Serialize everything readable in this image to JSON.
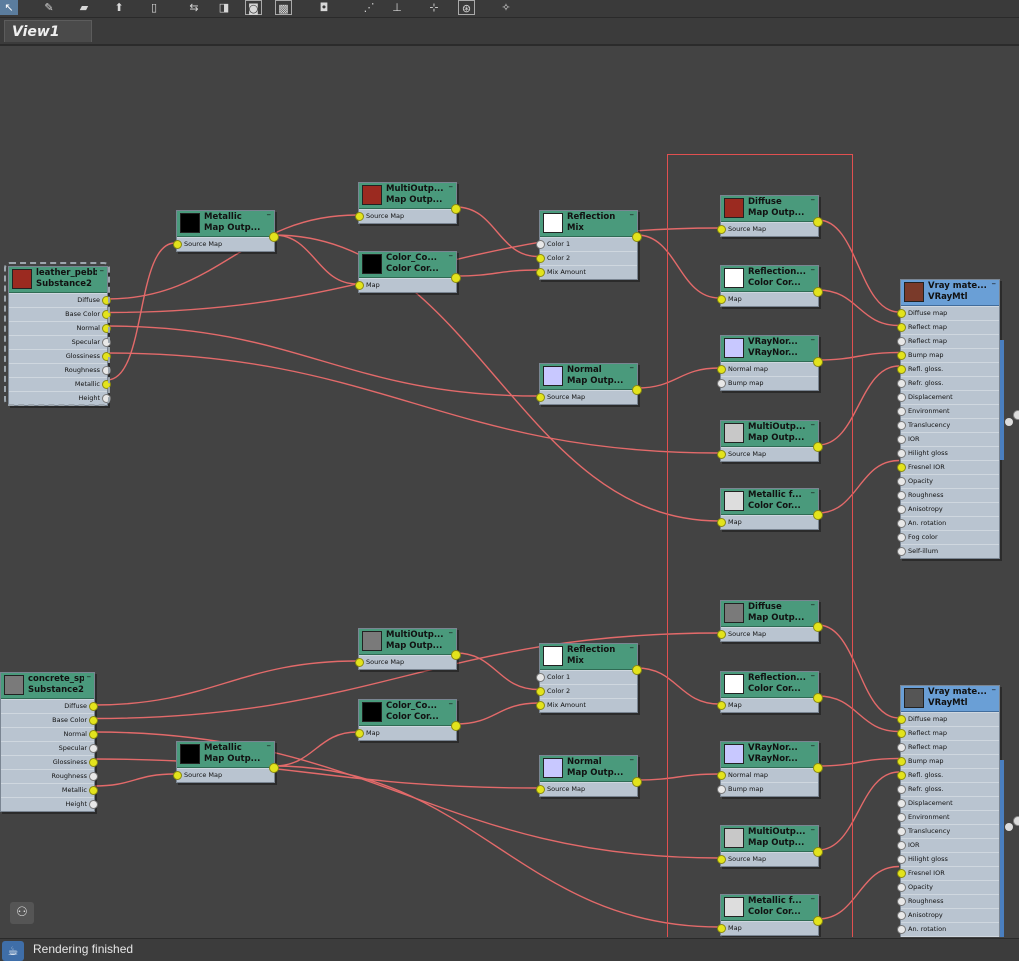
{
  "window": {
    "tab": "View1"
  },
  "toolbar": {
    "buttons": [
      {
        "name": "select-tool-icon",
        "glyph": "↖",
        "active": true
      },
      {
        "name": "pencil-icon",
        "glyph": "✎",
        "active": false
      },
      {
        "name": "brush-icon",
        "glyph": "▰",
        "active": false
      },
      {
        "name": "bucket-icon",
        "glyph": "⬆",
        "active": false
      },
      {
        "name": "delete-icon",
        "glyph": "▯",
        "active": false
      },
      {
        "name": "move-children-icon",
        "glyph": "⇆",
        "active": false
      },
      {
        "name": "hide-unused-icon",
        "glyph": "◨",
        "active": false
      },
      {
        "name": "show-map-icon",
        "glyph": "◙",
        "active": false
      },
      {
        "name": "show-bg-icon",
        "glyph": "▩",
        "active": false
      },
      {
        "name": "layout-icon",
        "glyph": "◘",
        "active": false
      },
      {
        "name": "arrange-icon",
        "glyph": "⋰",
        "active": false
      },
      {
        "name": "align-icon",
        "glyph": "⊥",
        "active": false
      },
      {
        "name": "nav-icon",
        "glyph": "⊹",
        "active": false
      },
      {
        "name": "zoom-icon",
        "glyph": "⊛",
        "active": false
      },
      {
        "name": "render-icon",
        "glyph": "✧",
        "active": false
      }
    ]
  },
  "nodes": {
    "sub1": {
      "title1": "leather_pebb...",
      "title2": "Substance2",
      "swatch": "#9b2a20",
      "outputs": [
        "Diffuse",
        "Base Color",
        "Normal",
        "Specular",
        "Glossiness",
        "Roughness",
        "Metallic",
        "Height"
      ]
    },
    "sub2": {
      "title1": "concrete_sp...",
      "title2": "Substance2",
      "swatch": "#7a7a7a",
      "outputs": [
        "Diffuse",
        "Base Color",
        "Normal",
        "Specular",
        "Glossiness",
        "Roughness",
        "Metallic",
        "Height"
      ]
    },
    "metal1": {
      "title1": "Metallic",
      "title2": "Map Outp...",
      "swatch": "#000000",
      "inputs": [
        "Source Map"
      ]
    },
    "multi1": {
      "title1": "MultiOutp...",
      "title2": "Map Outp...",
      "swatch": "#9b2a20",
      "inputs": [
        "Source Map"
      ]
    },
    "colcor1": {
      "title1": "Color_Co...",
      "title2": "Color Cor...",
      "swatch": "#000000",
      "inputs": [
        "Map"
      ]
    },
    "refmix1": {
      "title1": "Reflection",
      "title2": "Mix",
      "swatch": "#ffffff",
      "inputs": [
        "Color 1",
        "Color 2",
        "Mix Amount"
      ]
    },
    "normmap1": {
      "title1": "Normal",
      "title2": "Map Outp...",
      "swatch": "#c8c8ff",
      "inputs": [
        "Source Map"
      ]
    },
    "diff1": {
      "title1": "Diffuse",
      "title2": "Map Outp...",
      "swatch": "#9b2a20",
      "inputs": [
        "Source Map"
      ]
    },
    "refcc1": {
      "title1": "Reflection...",
      "title2": "Color Cor...",
      "swatch": "#ffffff",
      "inputs": [
        "Map"
      ]
    },
    "vnorm1": {
      "title1": "VRayNor...",
      "title2": "VRayNor...",
      "swatch": "#c8c8ff",
      "inputs": [
        "Normal map",
        "Bump map"
      ]
    },
    "multi1b": {
      "title1": "MultiOutp...",
      "title2": "Map Outp...",
      "swatch": "#c8c8c8",
      "inputs": [
        "Source Map"
      ]
    },
    "metcc1": {
      "title1": "Metallic f...",
      "title2": "Color Cor...",
      "swatch": "#dddddd",
      "inputs": [
        "Map"
      ]
    },
    "vmtl1": {
      "title1": "Vray mate...",
      "title2": "VRayMtl",
      "swatch": "#7a3a2a",
      "inputs": [
        "Diffuse map",
        "Reflect map",
        "Reflect map",
        "Bump map",
        "Refl. gloss.",
        "Refr. gloss.",
        "Displacement",
        "Environment",
        "Translucency",
        "IOR",
        "Hilight gloss",
        "Fresnel IOR",
        "Opacity",
        "Roughness",
        "Anisotropy",
        "An. rotation",
        "Fog color",
        "Self-illum"
      ]
    },
    "multi2": {
      "title1": "MultiOutp...",
      "title2": "Map Outp...",
      "swatch": "#7a7a7a",
      "inputs": [
        "Source Map"
      ]
    },
    "colcor2": {
      "title1": "Color_Co...",
      "title2": "Color Cor...",
      "swatch": "#000000",
      "inputs": [
        "Map"
      ]
    },
    "metal2": {
      "title1": "Metallic",
      "title2": "Map Outp...",
      "swatch": "#000000",
      "inputs": [
        "Source Map"
      ]
    },
    "refmix2": {
      "title1": "Reflection",
      "title2": "Mix",
      "swatch": "#ffffff",
      "inputs": [
        "Color 1",
        "Color 2",
        "Mix Amount"
      ]
    },
    "normmap2": {
      "title1": "Normal",
      "title2": "Map Outp...",
      "swatch": "#c8c8ff",
      "inputs": [
        "Source Map"
      ]
    },
    "diff2": {
      "title1": "Diffuse",
      "title2": "Map Outp...",
      "swatch": "#7a7a7a",
      "inputs": [
        "Source Map"
      ]
    },
    "refcc2": {
      "title1": "Reflection...",
      "title2": "Color Cor...",
      "swatch": "#ffffff",
      "inputs": [
        "Map"
      ]
    },
    "vnorm2": {
      "title1": "VRayNor...",
      "title2": "VRayNor...",
      "swatch": "#c8c8ff",
      "inputs": [
        "Normal map",
        "Bump map"
      ]
    },
    "multi2b": {
      "title1": "MultiOutp...",
      "title2": "Map Outp...",
      "swatch": "#c8c8c8",
      "inputs": [
        "Source Map"
      ]
    },
    "metcc2": {
      "title1": "Metallic f...",
      "title2": "Color Cor...",
      "swatch": "#dddddd",
      "inputs": [
        "Map"
      ]
    },
    "vmtl2": {
      "title1": "Vray mate...",
      "title2": "VRayMtl",
      "swatch": "#555555",
      "inputs": [
        "Diffuse map",
        "Reflect map",
        "Reflect map",
        "Bump map",
        "Refl. gloss.",
        "Refr. gloss.",
        "Displacement",
        "Environment",
        "Translucency",
        "IOR",
        "Hilight gloss",
        "Fresnel IOR",
        "Opacity",
        "Roughness",
        "Anisotropy",
        "An. rotation",
        "Fog color"
      ]
    }
  },
  "status": {
    "text": "Rendering finished"
  },
  "colors": {
    "wire": "#e36a6a",
    "selection": "#e05050",
    "node_header": "#4a9a7c",
    "vray_header": "#6a9fd6"
  }
}
